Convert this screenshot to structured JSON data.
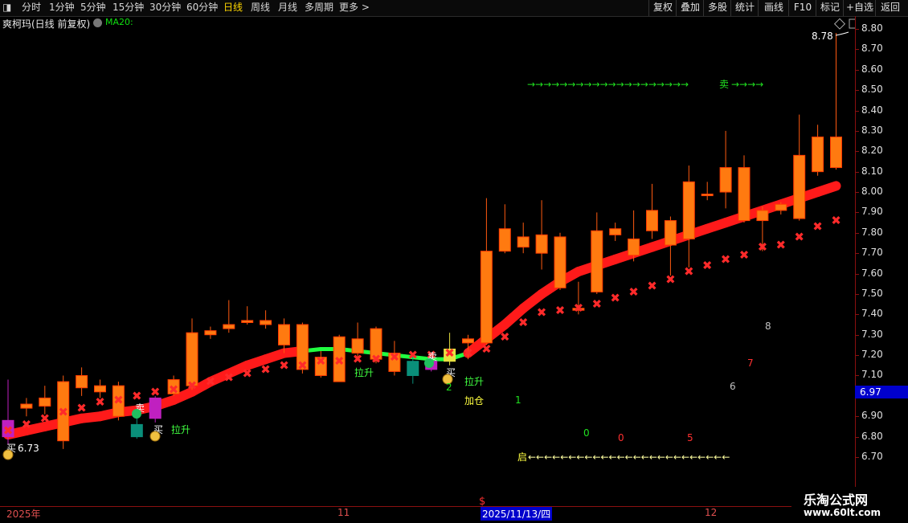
{
  "toolbar": {
    "items": [
      "分时",
      "1分钟",
      "5分钟",
      "15分钟",
      "30分钟",
      "60分钟",
      "日线",
      "周线",
      "月线",
      "多周期",
      "更多 >"
    ],
    "active": "日线",
    "right_buttons": [
      "复权",
      "叠加",
      "多股",
      "统计",
      "画线",
      "F10",
      "标记",
      "+自选",
      "返回"
    ]
  },
  "chart_title": "爽柯玛(日线 前复权)",
  "ma_label": "MA20:",
  "yaxis_ticks": [
    "8.80",
    "8.70",
    "8.60",
    "8.50",
    "8.40",
    "8.30",
    "8.20",
    "8.10",
    "8.00",
    "7.90",
    "7.80",
    "7.70",
    "7.60",
    "7.50",
    "7.40",
    "7.30",
    "7.20",
    "7.10",
    "7.00",
    "6.90",
    "6.80",
    "6.70"
  ],
  "current_price": "6.97",
  "xaxis": {
    "labels": [
      "2025年",
      "11",
      "12"
    ],
    "selected": "2025/11/13/四"
  },
  "watermark": {
    "line1": "乐淘公式网",
    "line2": "www.60lt.com"
  },
  "colors": {
    "up": "#ff3a1a",
    "body_fill": "#ff6a10",
    "bg": "#000000",
    "ma": "#ff1a1a",
    "ma_down": "#20ff40",
    "axis": "#8a1010"
  },
  "chart_data": {
    "type": "candlestick",
    "ylim": [
      6.66,
      8.84
    ],
    "candles": [
      {
        "o": 6.8,
        "c": 6.88,
        "h": 7.08,
        "l": 6.76,
        "color": "magenta"
      },
      {
        "o": 6.94,
        "c": 6.96,
        "h": 6.99,
        "l": 6.9,
        "color": "orange"
      },
      {
        "o": 6.95,
        "c": 6.99,
        "h": 7.05,
        "l": 6.91,
        "color": "orange"
      },
      {
        "o": 7.07,
        "c": 6.78,
        "h": 7.1,
        "l": 6.74,
        "color": "orange"
      },
      {
        "o": 7.1,
        "c": 7.04,
        "h": 7.14,
        "l": 7.0,
        "color": "orange"
      },
      {
        "o": 7.05,
        "c": 7.02,
        "h": 7.08,
        "l": 6.99,
        "color": "orange"
      },
      {
        "o": 7.05,
        "c": 6.9,
        "h": 7.07,
        "l": 6.88,
        "color": "orange"
      },
      {
        "o": 6.86,
        "c": 6.8,
        "h": 6.92,
        "l": 6.79,
        "color": "teal"
      },
      {
        "o": 6.89,
        "c": 6.99,
        "h": 7.0,
        "l": 6.87,
        "color": "magenta"
      },
      {
        "o": 7.01,
        "c": 7.08,
        "h": 7.1,
        "l": 7.0,
        "color": "orange"
      },
      {
        "o": 7.31,
        "c": 7.05,
        "h": 7.38,
        "l": 7.03,
        "color": "orange"
      },
      {
        "o": 7.32,
        "c": 7.3,
        "h": 7.34,
        "l": 7.28,
        "color": "orange"
      },
      {
        "o": 7.35,
        "c": 7.33,
        "h": 7.47,
        "l": 7.31,
        "color": "orange"
      },
      {
        "o": 7.37,
        "c": 7.36,
        "h": 7.44,
        "l": 7.35,
        "color": "orange"
      },
      {
        "o": 7.37,
        "c": 7.35,
        "h": 7.42,
        "l": 7.33,
        "color": "orange"
      },
      {
        "o": 7.35,
        "c": 7.25,
        "h": 7.38,
        "l": 7.21,
        "color": "orange"
      },
      {
        "o": 7.35,
        "c": 7.13,
        "h": 7.36,
        "l": 7.11,
        "color": "orange"
      },
      {
        "o": 7.19,
        "c": 7.1,
        "h": 7.22,
        "l": 7.09,
        "color": "orange"
      },
      {
        "o": 7.29,
        "c": 7.07,
        "h": 7.3,
        "l": 7.07,
        "color": "orange"
      },
      {
        "o": 7.28,
        "c": 7.21,
        "h": 7.36,
        "l": 7.19,
        "color": "orange"
      },
      {
        "o": 7.33,
        "c": 7.18,
        "h": 7.34,
        "l": 7.16,
        "color": "orange"
      },
      {
        "o": 7.21,
        "c": 7.12,
        "h": 7.27,
        "l": 7.1,
        "color": "orange"
      },
      {
        "o": 7.17,
        "c": 7.1,
        "h": 7.2,
        "l": 7.06,
        "color": "teal"
      },
      {
        "o": 7.17,
        "c": 7.13,
        "h": 7.19,
        "l": 7.12,
        "color": "magenta"
      },
      {
        "o": 7.23,
        "c": 7.17,
        "h": 7.31,
        "l": 7.15,
        "color": "yellow"
      },
      {
        "o": 7.28,
        "c": 7.26,
        "h": 7.3,
        "l": 7.18,
        "color": "orange"
      },
      {
        "o": 7.71,
        "c": 7.26,
        "h": 7.97,
        "l": 7.25,
        "color": "orange"
      },
      {
        "o": 7.82,
        "c": 7.71,
        "h": 7.94,
        "l": 7.7,
        "color": "orange"
      },
      {
        "o": 7.78,
        "c": 7.73,
        "h": 7.85,
        "l": 7.7,
        "color": "orange"
      },
      {
        "o": 7.79,
        "c": 7.7,
        "h": 7.96,
        "l": 7.62,
        "color": "orange"
      },
      {
        "o": 7.78,
        "c": 7.53,
        "h": 7.8,
        "l": 7.52,
        "color": "orange"
      },
      {
        "o": 7.43,
        "c": 7.42,
        "h": 7.56,
        "l": 7.4,
        "color": "orange"
      },
      {
        "o": 7.81,
        "c": 7.51,
        "h": 7.9,
        "l": 7.5,
        "color": "orange"
      },
      {
        "o": 7.82,
        "c": 7.79,
        "h": 7.85,
        "l": 7.76,
        "color": "orange"
      },
      {
        "o": 7.77,
        "c": 7.69,
        "h": 7.91,
        "l": 7.66,
        "color": "orange"
      },
      {
        "o": 7.91,
        "c": 7.81,
        "h": 8.04,
        "l": 7.77,
        "color": "orange"
      },
      {
        "o": 7.86,
        "c": 7.74,
        "h": 7.88,
        "l": 7.59,
        "color": "orange"
      },
      {
        "o": 8.05,
        "c": 7.77,
        "h": 8.13,
        "l": 7.63,
        "color": "orange"
      },
      {
        "o": 7.99,
        "c": 7.99,
        "h": 8.05,
        "l": 7.96,
        "color": "orange"
      },
      {
        "o": 8.12,
        "c": 8.0,
        "h": 8.3,
        "l": 7.92,
        "color": "orange"
      },
      {
        "o": 8.12,
        "c": 7.86,
        "h": 8.18,
        "l": 7.85,
        "color": "orange"
      },
      {
        "o": 7.91,
        "c": 7.86,
        "h": 7.93,
        "l": 7.71,
        "color": "orange"
      },
      {
        "o": 7.94,
        "c": 7.91,
        "h": 7.95,
        "l": 7.89,
        "color": "orange"
      },
      {
        "o": 8.18,
        "c": 7.87,
        "h": 8.38,
        "l": 7.86,
        "color": "orange"
      },
      {
        "o": 8.27,
        "c": 8.1,
        "h": 8.33,
        "l": 8.08,
        "color": "orange"
      },
      {
        "o": 8.27,
        "c": 8.12,
        "h": 8.78,
        "l": 8.11,
        "color": "orange"
      }
    ],
    "ma20": [
      6.81,
      6.83,
      6.85,
      6.87,
      6.89,
      6.9,
      6.92,
      6.93,
      6.95,
      6.98,
      7.02,
      7.07,
      7.11,
      7.15,
      7.18,
      7.21,
      7.22,
      7.23,
      7.23,
      7.22,
      7.21,
      7.2,
      7.19,
      7.18,
      7.18,
      7.21,
      7.28,
      7.35,
      7.43,
      7.5,
      7.56,
      7.61,
      7.64,
      7.67,
      7.7,
      7.73,
      7.76,
      7.79,
      7.82,
      7.85,
      7.88,
      7.91,
      7.94,
      7.97,
      8.0,
      8.03
    ],
    "ma20_down_range": [
      16,
      25
    ],
    "markers": [
      6.83,
      6.86,
      6.89,
      6.92,
      6.94,
      6.97,
      6.98,
      7.0,
      7.02,
      7.03,
      7.05,
      7.07,
      7.09,
      7.11,
      7.13,
      7.15,
      7.15,
      7.17,
      7.17,
      7.18,
      7.18,
      7.19,
      7.2,
      7.2,
      7.21,
      7.21,
      7.23,
      7.29,
      7.36,
      7.41,
      7.42,
      7.43,
      7.45,
      7.48,
      7.51,
      7.54,
      7.57,
      7.61,
      7.64,
      7.67,
      7.69,
      7.73,
      7.74,
      7.78,
      7.83,
      7.86
    ],
    "annotations": {
      "buy": "买",
      "sell": "卖",
      "rise": "拉升",
      "add": "加仓",
      "start": "启",
      "low_label": "6.73",
      "high_label": "8.78",
      "count_digits": [
        "0",
        "1",
        "2",
        "5",
        "6",
        "7",
        "8"
      ],
      "dollar": "$"
    }
  }
}
